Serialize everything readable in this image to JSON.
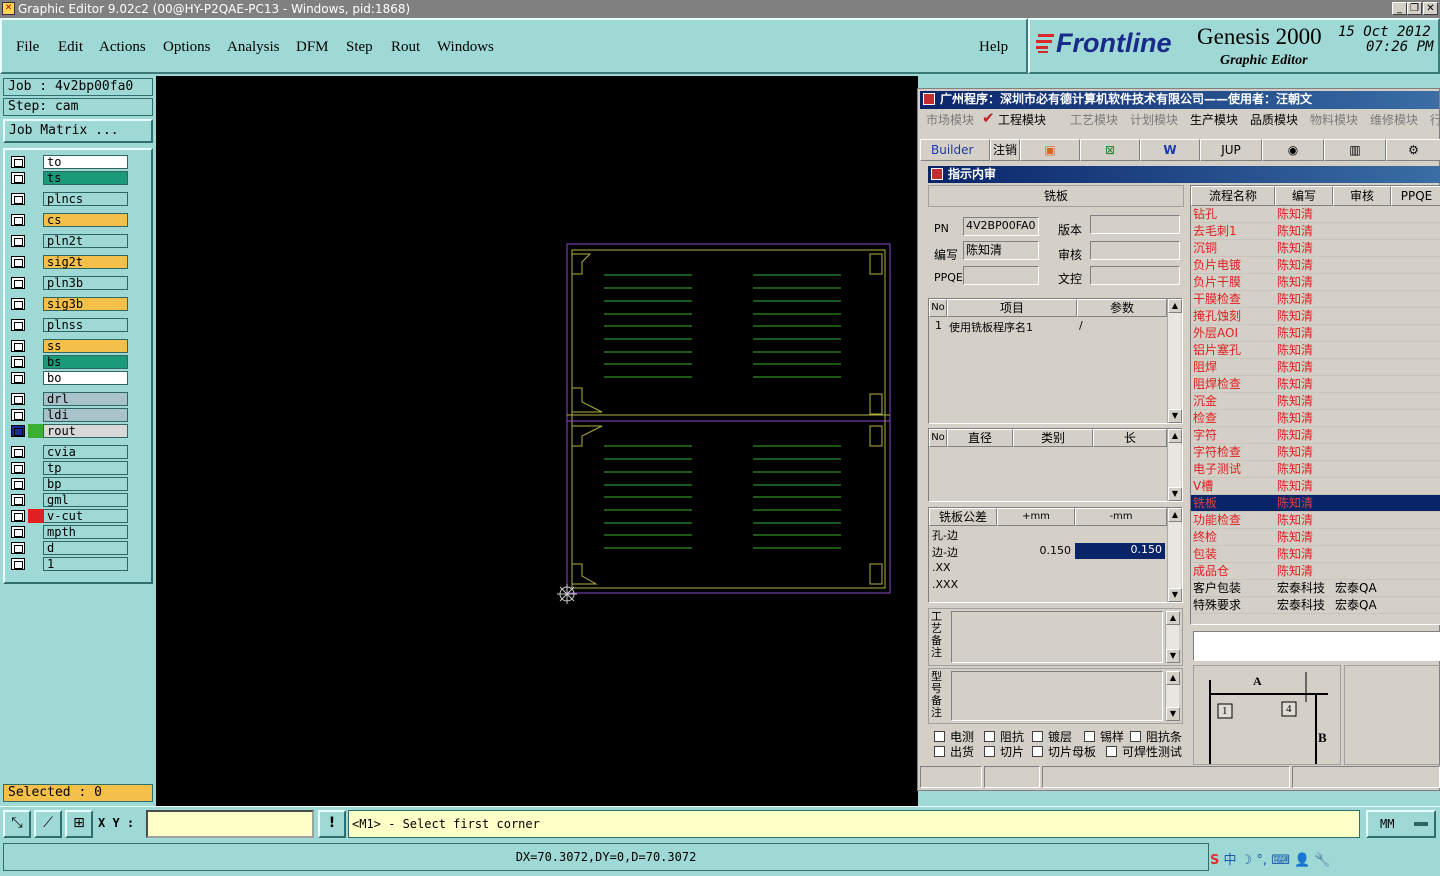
{
  "window": {
    "title": "Graphic Editor 9.02c2 (00@HY-P2QAE-PC13 - Windows, pid:1868)"
  },
  "menu": [
    "File",
    "Edit",
    "Actions",
    "Options",
    "Analysis",
    "DFM",
    "Step",
    "Rout",
    "Windows"
  ],
  "help": "Help",
  "brand": {
    "logo": "Frontline",
    "product": "Genesis 2000",
    "subtitle": "Graphic Editor",
    "date": "15 Oct 2012",
    "time": "07:26 PM"
  },
  "job": {
    "job_label": "Job : 4v2bp00fa0",
    "step_label": "Step: cam",
    "matrix_button": "Job Matrix ..."
  },
  "layers": [
    {
      "name": "to",
      "color": "#ffffff"
    },
    {
      "name": "ts",
      "color": "#1a9a78"
    },
    {
      "name": "plncs",
      "color": "#9fd9d6"
    },
    {
      "name": "cs",
      "color": "#f5c04a"
    },
    {
      "name": "pln2t",
      "color": "#9fd9d6"
    },
    {
      "name": "sig2t",
      "color": "#f5c04a"
    },
    {
      "name": "pln3b",
      "color": "#9fd9d6"
    },
    {
      "name": "sig3b",
      "color": "#f5c04a"
    },
    {
      "name": "plnss",
      "color": "#9fd9d6"
    },
    {
      "name": "ss",
      "color": "#f5c04a"
    },
    {
      "name": "bs",
      "color": "#1a9a78"
    },
    {
      "name": "bo",
      "color": "#ffffff"
    },
    {
      "name": "drl",
      "color": "#a9c1c8"
    },
    {
      "name": "ldi",
      "color": "#a9c1c8"
    },
    {
      "name": "rout",
      "color": "#d8d8d8"
    },
    {
      "name": "cvia",
      "color": "#9fd9d6"
    },
    {
      "name": "tp",
      "color": "#9fd9d6"
    },
    {
      "name": "bp",
      "color": "#9fd9d6"
    },
    {
      "name": "gml",
      "color": "#9fd9d6"
    },
    {
      "name": "v-cut",
      "color": "#9fd9d6"
    },
    {
      "name": "mpth",
      "color": "#9fd9d6"
    },
    {
      "name": "d",
      "color": "#9fd9d6"
    },
    {
      "name": "1",
      "color": "#9fd9d6"
    }
  ],
  "selected": "Selected : 0",
  "bottom": {
    "xy_label": "X Y :",
    "xy_value": "",
    "prompt": "<M1> - Select first corner",
    "units": "MM",
    "status": "DX=70.3072,DY=0,D=70.3072"
  },
  "dialog": {
    "title": "广州程序：深圳市必有德计算机软件技术有限公司——使用者：汪朝文",
    "modules": [
      "市场模块",
      "工程模块",
      "工艺模块",
      "计划模块",
      "生产模块",
      "品质模块",
      "物料模块",
      "维修模块",
      "行"
    ],
    "toolbar": [
      "Builder",
      "注销",
      "JUP"
    ],
    "subtitle": "指示内审",
    "section": "铣板",
    "fields": {
      "pn_label": "PN",
      "pn_value": "4V2BP00FA0",
      "version_label": "版本",
      "author_label": "编写",
      "author_value": "陈知清",
      "review_label": "审核",
      "ppqe_label": "PPQE",
      "doc_label": "文控"
    },
    "grid1": {
      "headers": [
        "No",
        "项目",
        "参数"
      ],
      "rows": [
        [
          "1",
          "使用铣板程序名1",
          "/"
        ]
      ]
    },
    "grid2": {
      "headers": [
        "No",
        "直径",
        "类别",
        "长"
      ]
    },
    "grid3": {
      "headers": [
        "铣板公差",
        "+mm",
        "-mm"
      ],
      "rows": [
        [
          "孔-边",
          "",
          ""
        ],
        [
          "边-边",
          "0.150",
          "0.150"
        ],
        [
          ".XX",
          "",
          ""
        ],
        [
          ".XXX",
          "",
          ""
        ]
      ]
    },
    "remark1": "工艺备注",
    "remark2": "型号备注",
    "checks": [
      [
        "电测",
        "阻抗",
        "镀层",
        "锡样",
        "阻抗条"
      ],
      [
        "出货",
        "切片",
        "切片母板",
        "可焊性测试"
      ]
    ],
    "flow_headers": [
      "流程名称",
      "编写",
      "审核",
      "PPQE"
    ],
    "flow": [
      [
        "钻孔",
        "陈知清",
        "",
        "red"
      ],
      [
        "去毛刺1",
        "陈知清",
        "",
        "red"
      ],
      [
        "沉铜",
        "陈知清",
        "",
        "red"
      ],
      [
        "负片电镀",
        "陈知清",
        "",
        "red"
      ],
      [
        "负片干膜",
        "陈知清",
        "",
        "red"
      ],
      [
        "干膜检查",
        "陈知清",
        "",
        "red"
      ],
      [
        "掩孔蚀刻",
        "陈知清",
        "",
        "red"
      ],
      [
        "外层AOI",
        "陈知清",
        "",
        "red"
      ],
      [
        "铝片塞孔",
        "陈知清",
        "",
        "red"
      ],
      [
        "阻焊",
        "陈知清",
        "",
        "red"
      ],
      [
        "阻焊检查",
        "陈知清",
        "",
        "red"
      ],
      [
        "沉金",
        "陈知清",
        "",
        "red"
      ],
      [
        "检查",
        "陈知清",
        "",
        "red"
      ],
      [
        "字符",
        "陈知清",
        "",
        "red"
      ],
      [
        "字符检查",
        "陈知清",
        "",
        "red"
      ],
      [
        "电子测试",
        "陈知清",
        "",
        "red"
      ],
      [
        "V槽",
        "陈知清",
        "",
        "red"
      ],
      [
        "铣板",
        "陈知清",
        "",
        "sel"
      ],
      [
        "功能检查",
        "陈知清",
        "",
        "red"
      ],
      [
        "终检",
        "陈知清",
        "",
        "red"
      ],
      [
        "包装",
        "陈知清",
        "",
        "red"
      ],
      [
        "成品仓",
        "陈知清",
        "",
        "red"
      ],
      [
        "客户包装",
        "宏泰科技",
        "宏泰QA",
        "black"
      ],
      [
        "特殊要求",
        "宏泰科技",
        "宏泰QA",
        "black"
      ]
    ],
    "diagram": {
      "a": "A",
      "b": "B",
      "n1": "1",
      "n4": "4"
    }
  }
}
